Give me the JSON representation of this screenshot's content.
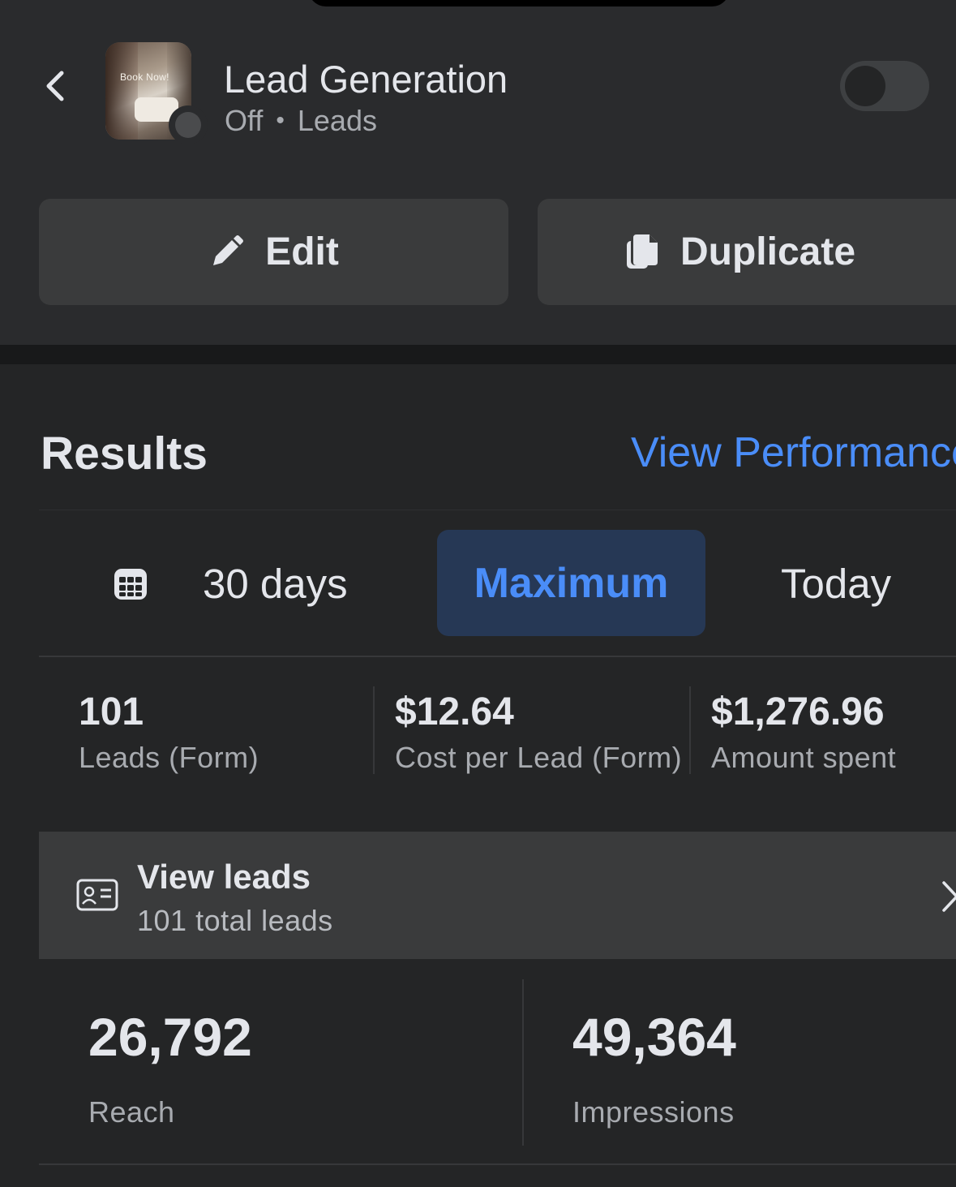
{
  "header": {
    "title": "Lead Generation",
    "status": "Off",
    "separator": "•",
    "objective": "Leads",
    "thumbnail_text": "Book Now!",
    "toggle_on": false
  },
  "actions": {
    "edit_label": "Edit",
    "duplicate_label": "Duplicate"
  },
  "results": {
    "title": "Results",
    "performance_link": "View Performance"
  },
  "date_ranges": {
    "option_30": "30 days",
    "option_max": "Maximum",
    "option_today": "Today",
    "selected": "Maximum"
  },
  "metrics": [
    {
      "value": "101",
      "label": "Leads (Form)"
    },
    {
      "value": "$12.64",
      "label": "Cost per Lead (Form)"
    },
    {
      "value": "$1,276.96",
      "label": "Amount spent"
    }
  ],
  "leads": {
    "title": "View leads",
    "subtitle": "101 total leads"
  },
  "summary": [
    {
      "value": "26,792",
      "label": "Reach"
    },
    {
      "value": "49,364",
      "label": "Impressions"
    }
  ],
  "colors": {
    "background": "#242526",
    "panel": "#2a2b2d",
    "button": "#3a3b3c",
    "accent": "#4a8df8",
    "selected_bg": "#263855"
  }
}
